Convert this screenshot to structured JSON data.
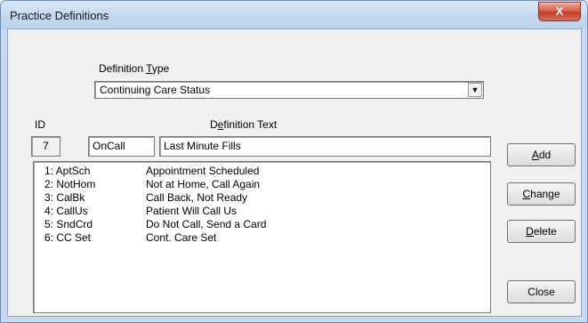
{
  "window": {
    "title": "Practice Definitions",
    "close_glyph": "X"
  },
  "definition_type": {
    "label_pre": "Definition ",
    "label_mnemonic": "T",
    "label_post": "ype",
    "value": "Continuing Care Status",
    "arrow_glyph": "▼"
  },
  "headers": {
    "id": "ID",
    "def_text_pre": "D",
    "def_text_mnemonic": "e",
    "def_text_post": "finition Text"
  },
  "fields": {
    "id_value": "7",
    "code_value": "OnCall",
    "text_value": "Last Minute Fills"
  },
  "list": {
    "items": [
      {
        "code": "1: AptSch",
        "desc": "Appointment Scheduled"
      },
      {
        "code": "2: NotHom",
        "desc": "Not at Home, Call Again"
      },
      {
        "code": "3: CalBk",
        "desc": "Call Back, Not Ready"
      },
      {
        "code": "4: CallUs",
        "desc": "Patient Will Call Us"
      },
      {
        "code": "5: SndCrd",
        "desc": "Do Not Call, Send a Card"
      },
      {
        "code": "6: CC Set",
        "desc": "Cont. Care Set"
      }
    ]
  },
  "buttons": {
    "add": {
      "mnemonic": "A",
      "rest": "dd"
    },
    "change": {
      "mnemonic": "C",
      "rest": "hange"
    },
    "delete": {
      "mnemonic": "D",
      "rest": "elete"
    },
    "close": {
      "label": "Close"
    }
  }
}
